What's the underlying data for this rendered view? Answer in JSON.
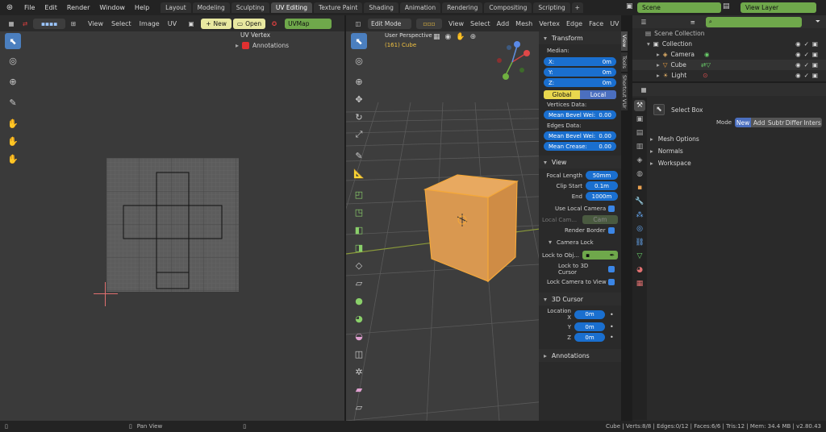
{
  "topbar": {
    "menus": [
      "File",
      "Edit",
      "Render",
      "Window",
      "Help"
    ],
    "workspaces": [
      "Layout",
      "Modeling",
      "Sculpting",
      "UV Editing",
      "Texture Paint",
      "Shading",
      "Animation",
      "Rendering",
      "Compositing",
      "Scripting"
    ],
    "active_workspace": "UV Editing",
    "add_tab": "+",
    "scene": "Scene",
    "view_layer": "View Layer"
  },
  "uv_editor": {
    "menus": [
      "View",
      "Select",
      "Image",
      "UV"
    ],
    "new_label": "New",
    "open_label": "Open",
    "uvmap": "UVMap",
    "panel_title": "UV Vertex",
    "annotations_label": "Annotations"
  },
  "viewport": {
    "mode": "Edit Mode",
    "menus": [
      "View",
      "Select",
      "Add",
      "Mesh",
      "Vertex",
      "Edge",
      "Face",
      "UV"
    ],
    "perspective": "User Perspective",
    "object_label": "(161) Cube"
  },
  "npanel": {
    "tabs": [
      "View",
      "Tools",
      "Shortcut VUr"
    ],
    "transform_title": "Transform",
    "median_label": "Median:",
    "x_label": "X:",
    "x_value": "0m",
    "y_label": "Y:",
    "y_value": "0m",
    "z_label": "Z:",
    "z_value": "0m",
    "global_label": "Global",
    "local_label": "Local",
    "vertices_data_label": "Vertices Data:",
    "mean_bevel_weight_label": "Mean Bevel Wei:",
    "mean_bevel_weight_value": "0.00",
    "edges_data_label": "Edges Data:",
    "edge_mean_bevel_label": "Mean Bevel Wei:",
    "edge_mean_bevel_value": "0.00",
    "mean_crease_label": "Mean Crease:",
    "mean_crease_value": "0.00",
    "view_title": "View",
    "focal_length_label": "Focal Length",
    "focal_length_value": "50mm",
    "clip_start_label": "Clip Start",
    "clip_start_value": "0.1m",
    "clip_end_label": "End",
    "clip_end_value": "1000m",
    "use_local_camera_label": "Use Local Camera",
    "local_camera_label": "Local Cam...",
    "local_camera_value": "Cam",
    "render_border_label": "Render Border",
    "camera_lock_title": "Camera Lock",
    "lock_to_object_label": "Lock to Obj...",
    "lock_3d_cursor_label": "Lock to 3D Cursor",
    "lock_camera_view_label": "Lock Camera to View",
    "cursor_title": "3D Cursor",
    "location_x_label": "Location X",
    "location_x_value": "0m",
    "location_y_label": "Y",
    "location_y_value": "0m",
    "location_z_label": "Z",
    "location_z_value": "0m",
    "annotations_title": "Annotations"
  },
  "outliner": {
    "scene_collection": "Scene Collection",
    "collection": "Collection",
    "items": [
      "Camera",
      "Cube",
      "Light"
    ]
  },
  "properties": {
    "select_box_label": "Select Box",
    "mode_label": "Mode",
    "modes": [
      "New",
      "Add",
      "Subtr",
      "Differ",
      "Inters"
    ],
    "active_mode": "New",
    "sections": [
      "Mesh Options",
      "Normals",
      "Workspace"
    ]
  },
  "statusbar": {
    "pan_view": "Pan View",
    "stats": "Cube | Verts:8/8 | Edges:0/12 | Faces:6/6 | Tris:12 | Mem: 34.4 MB | v2.80.43"
  },
  "colors": {
    "accent_blue": "#1a6fcf",
    "active_tab": "#4a4a4a",
    "selection_orange": "#f0a030",
    "green_field": "#6fa84b"
  }
}
